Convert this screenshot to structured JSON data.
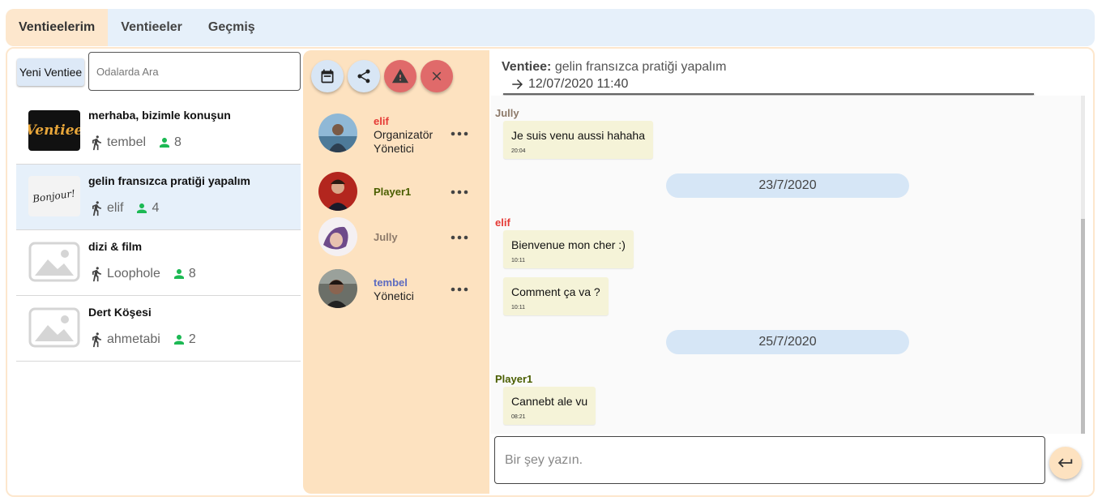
{
  "tabs": [
    {
      "label": "Ventieelerim",
      "active": true
    },
    {
      "label": "Ventieeler",
      "active": false
    },
    {
      "label": "Geçmiş",
      "active": false
    }
  ],
  "left": {
    "new_button": "Yeni Ventiee",
    "search_placeholder": "Odalarda Ara",
    "rooms": [
      {
        "title": "merhaba, bizimle konuşun",
        "owner": "tembel",
        "count": "8",
        "thumb": "Ventiee",
        "selected": false
      },
      {
        "title": "gelin fransızca pratiği yapalım",
        "owner": "elif",
        "count": "4",
        "thumb": "Bonjour!",
        "selected": true
      },
      {
        "title": "dizi & film",
        "owner": "Loophole",
        "count": "8",
        "thumb": "image-placeholder-icon",
        "selected": false
      },
      {
        "title": "Dert Köşesi",
        "owner": "ahmetabi",
        "count": "2",
        "thumb": "image-placeholder-icon",
        "selected": false
      }
    ]
  },
  "people": {
    "actions": [
      "calendar-icon",
      "share-icon",
      "warning-icon",
      "close-icon"
    ],
    "members": [
      {
        "name": "elif",
        "roles": [
          "Organizatör",
          "Yönetici"
        ],
        "color": "#e53935"
      },
      {
        "name": "Player1",
        "roles": [],
        "color": "#4a5e00"
      },
      {
        "name": "Jully",
        "roles": [],
        "color": "#8d7a6a"
      },
      {
        "name": "tembel",
        "roles": [
          "Yönetici"
        ],
        "color": "#5c6bc0"
      }
    ]
  },
  "chat": {
    "title_label": "Ventiee:",
    "title": "gelin fransızca pratiği yapalım",
    "datetime": "12/07/2020 11:40",
    "messages": [
      {
        "sender": "Jully",
        "color": "#8d7a6a",
        "text": "Je suis venu aussi hahaha",
        "time": "20:04"
      },
      {
        "date": "23/7/2020"
      },
      {
        "sender": "elif",
        "color": "#e53935",
        "text": "Bienvenue mon cher :)",
        "time": "10:11"
      },
      {
        "text": "Comment ça va ?",
        "time": "10:11"
      },
      {
        "date": "25/7/2020"
      },
      {
        "sender": "Player1",
        "color": "#4a5e00",
        "text": "Cannebt ale vu",
        "time": "08:21"
      }
    ],
    "input_placeholder": "Bir şey yazın."
  },
  "colors": {
    "accent_peach": "#fde2c0",
    "accent_blue": "#e6f0fa",
    "danger": "#e06a6a",
    "online_green": "#1db954"
  }
}
